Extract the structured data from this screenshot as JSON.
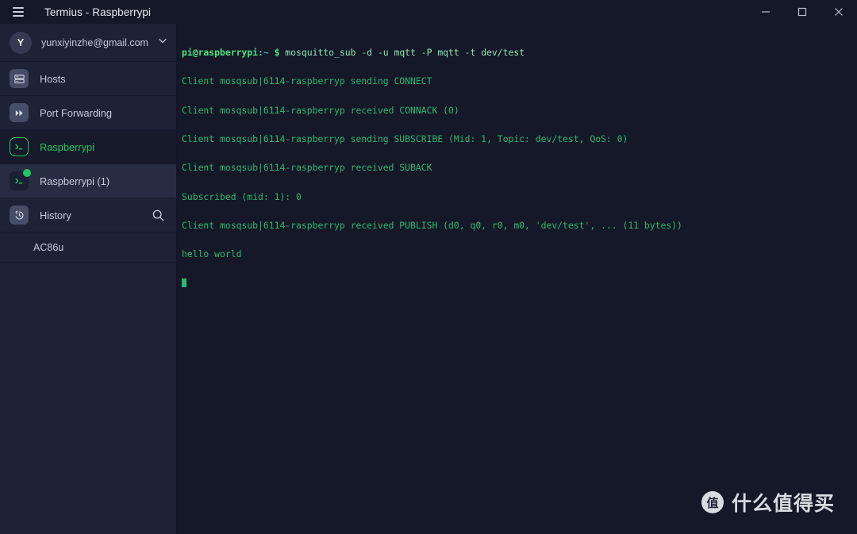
{
  "window": {
    "title": "Termius - Raspberrypi",
    "menu_icon": "hamburger-icon",
    "minimize_label": "—",
    "maximize_label": "□",
    "close_label": "✕"
  },
  "sidebar": {
    "account": {
      "avatar_initial": "Y",
      "email": "yunxiyinzhe@gmail.com",
      "chevron_icon": "chevron-down-icon"
    },
    "items": [
      {
        "label": "Hosts",
        "icon": "server-icon",
        "state": "default"
      },
      {
        "label": "Port Forwarding",
        "icon": "port-forwarding-icon",
        "state": "default"
      },
      {
        "label": "Raspberrypi",
        "icon": "terminal-icon",
        "state": "active"
      },
      {
        "label": "Raspberrypi (1)",
        "icon": "terminal-icon",
        "state": "session",
        "online": true
      },
      {
        "label": "History",
        "icon": "history-icon",
        "state": "default",
        "action_icon": "search-icon"
      }
    ],
    "sub_items": [
      {
        "label": "AC86u"
      }
    ]
  },
  "terminal": {
    "prompt_user": "pi@raspberrypi",
    "prompt_path": ":~",
    "prompt_symbol": "$",
    "command": " mosquitto_sub -d -u mqtt -P mqtt -t dev/test",
    "output_lines": [
      "Client mosqsub|6114-raspberryp sending CONNECT",
      "Client mosqsub|6114-raspberryp received CONNACK (0)",
      "Client mosqsub|6114-raspberryp sending SUBSCRIBE (Mid: 1, Topic: dev/test, QoS: 0)",
      "Client mosqsub|6114-raspberryp received SUBACK",
      "Subscribed (mid: 1): 0",
      "Client mosqsub|6114-raspberryp received PUBLISH (d0, q0, r0, m0, 'dev/test', ... (11 bytes))",
      "hello world"
    ]
  },
  "watermark": {
    "logo_char": "值",
    "text": "什么值得买"
  },
  "colors": {
    "accent_green": "#22c55e",
    "terminal_bg": "#151827",
    "sidebar_bg": "#1e2236",
    "session_bg": "#272c42"
  }
}
